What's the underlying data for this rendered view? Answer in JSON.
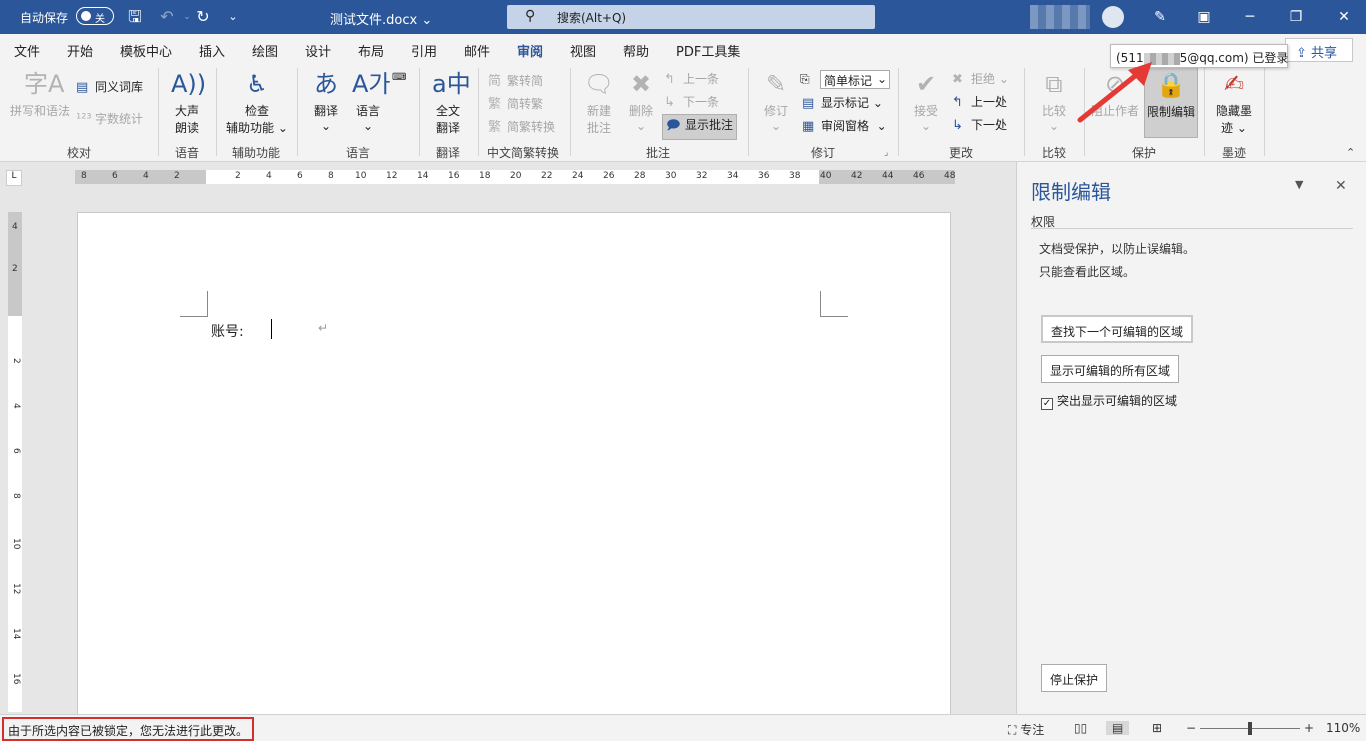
{
  "titlebar": {
    "autosave_label": "自动保存",
    "autosave_state": "关",
    "doc_title": "测试文件.docx",
    "search_placeholder": "搜索(Alt+Q)",
    "accent": "#2b579a"
  },
  "tabs": [
    "文件",
    "开始",
    "模板中心",
    "插入",
    "绘图",
    "设计",
    "布局",
    "引用",
    "邮件",
    "审阅",
    "视图",
    "帮助",
    "PDF工具集"
  ],
  "active_tab": "审阅",
  "share_label": "共享",
  "tooltip": {
    "prefix": "(511",
    "suffix": "5@qq.com) 已登录"
  },
  "ribbon": {
    "groups": {
      "proofing": "校对",
      "speech": "语音",
      "accessibility": "辅助功能",
      "language": "语言",
      "translate": "翻译",
      "chinese": "中文简繁转换",
      "comments": "批注",
      "tracking": "修订",
      "changes": "更改",
      "compare": "比较",
      "protect": "保护",
      "ink": "墨迹"
    },
    "spelling": "拼写和语法",
    "thesaurus": "同义词库",
    "wordcount": "字数统计",
    "readaloud": [
      "大声",
      "朗读"
    ],
    "accessibility_btn": [
      "检查",
      "辅助功能"
    ],
    "translate_btn": "翻译",
    "language_btn": "语言",
    "fulltranslate": [
      "全文",
      "翻译"
    ],
    "trad_to_simp": "繁转简",
    "simp_to_trad": "简转繁",
    "conversion": "简繁转换",
    "new_comment": [
      "新建",
      "批注"
    ],
    "delete": "删除",
    "prev_comment": "上一条",
    "next_comment": "下一条",
    "show_comments": "显示批注",
    "track": "修订",
    "markup_mode": "简单标记",
    "show_markup": "显示标记",
    "review_pane": "审阅窗格",
    "accept": "接受",
    "reject": "拒绝",
    "prev_change": "上一处",
    "next_change": "下一处",
    "compare_btn": "比较",
    "block_authors": "阻止作者",
    "restrict_editing": "限制编辑",
    "hide_ink": [
      "隐藏墨",
      "迹"
    ]
  },
  "ruler": {
    "h_left": [
      "8",
      "6",
      "4",
      "2"
    ],
    "h_right": [
      "2",
      "4",
      "6",
      "8",
      "10",
      "12",
      "14",
      "16",
      "18",
      "20",
      "22",
      "24",
      "26",
      "28",
      "30",
      "32",
      "34",
      "36",
      "38",
      "40",
      "42",
      "44",
      "46",
      "48"
    ],
    "v_top": [
      "4",
      "2"
    ],
    "v_bottom": [
      "2",
      "4",
      "6",
      "8",
      "10",
      "12",
      "14",
      "16"
    ]
  },
  "document": {
    "account_label": "账号:",
    "para_mark": "↵"
  },
  "pane": {
    "title": "限制编辑",
    "section": "权限",
    "line1": "文档受保护，以防止误编辑。",
    "line2": "只能查看此区域。",
    "btn_find_next": "查找下一个可编辑的区域",
    "btn_show_all": "显示可编辑的所有区域",
    "highlight_label": "突出显示可编辑的区域",
    "highlight_checked": true,
    "stop_protection": "停止保护"
  },
  "status": {
    "message": "由于所选内容已被锁定，您无法进行此更改。",
    "focus": "专注",
    "zoom": "110%"
  }
}
